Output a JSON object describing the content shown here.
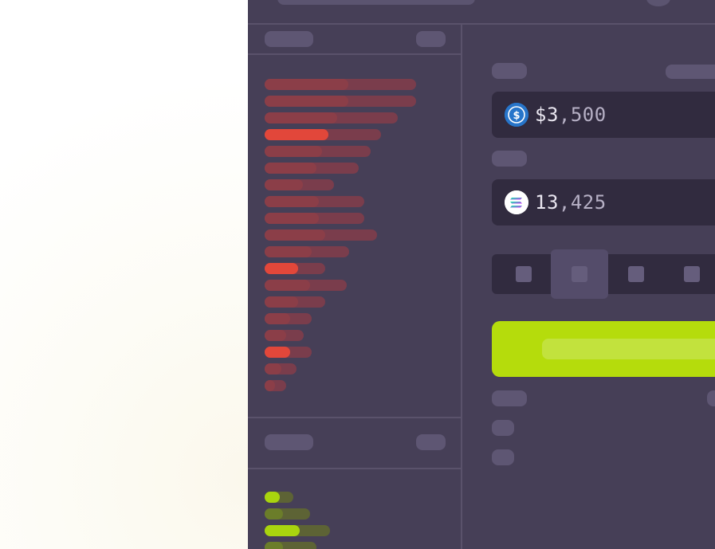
{
  "colors": {
    "app_bg": "#463f57",
    "divider": "#5a526b",
    "placeholder": "#5e5673",
    "ask_bar_bg": "#7a3d4c",
    "ask_bar_fg": "#8b3e48",
    "ask_bar_highlight": "#e2473a",
    "bid_bar_dark": "#6b7d2a",
    "bid_bar_highlight": "#a9d40e",
    "field_bg": "#312b3f",
    "accent_green": "#b5dc0c",
    "usdc_blue": "#2775ca"
  },
  "pay_field": {
    "icon": "usdc-dollar-icon",
    "amount_prefix": "$3",
    "amount_separator": ",",
    "amount_suffix": "500"
  },
  "receive_field": {
    "icon": "solana-icon",
    "amount_prefix": "13",
    "amount_separator": ",",
    "amount_suffix": "425"
  },
  "slippage_options": {
    "selected_index": 1,
    "count": 4
  },
  "asks": [
    {
      "fill": 0.55,
      "total": 1.0,
      "highlight": false
    },
    {
      "fill": 0.55,
      "total": 1.0,
      "highlight": false
    },
    {
      "fill": 0.48,
      "total": 0.88,
      "highlight": false
    },
    {
      "fill": 0.42,
      "total": 0.77,
      "highlight": true
    },
    {
      "fill": 0.38,
      "total": 0.7,
      "highlight": false
    },
    {
      "fill": 0.34,
      "total": 0.62,
      "highlight": false
    },
    {
      "fill": 0.25,
      "total": 0.46,
      "highlight": false
    },
    {
      "fill": 0.36,
      "total": 0.66,
      "highlight": false
    },
    {
      "fill": 0.36,
      "total": 0.66,
      "highlight": false
    },
    {
      "fill": 0.4,
      "total": 0.74,
      "highlight": false
    },
    {
      "fill": 0.31,
      "total": 0.56,
      "highlight": false
    },
    {
      "fill": 0.22,
      "total": 0.4,
      "highlight": true
    },
    {
      "fill": 0.3,
      "total": 0.54,
      "highlight": false
    },
    {
      "fill": 0.22,
      "total": 0.4,
      "highlight": false
    },
    {
      "fill": 0.17,
      "total": 0.31,
      "highlight": false
    },
    {
      "fill": 0.14,
      "total": 0.26,
      "highlight": false
    },
    {
      "fill": 0.17,
      "total": 0.31,
      "highlight": true
    },
    {
      "fill": 0.11,
      "total": 0.21,
      "highlight": false
    },
    {
      "fill": 0.07,
      "total": 0.14,
      "highlight": false
    }
  ],
  "bids": [
    {
      "fill": 0.1,
      "total": 0.19,
      "highlight": true
    },
    {
      "fill": 0.12,
      "total": 0.3,
      "highlight": false
    },
    {
      "fill": 0.23,
      "total": 0.43,
      "highlight": true
    },
    {
      "fill": 0.12,
      "total": 0.34,
      "highlight": false
    }
  ]
}
